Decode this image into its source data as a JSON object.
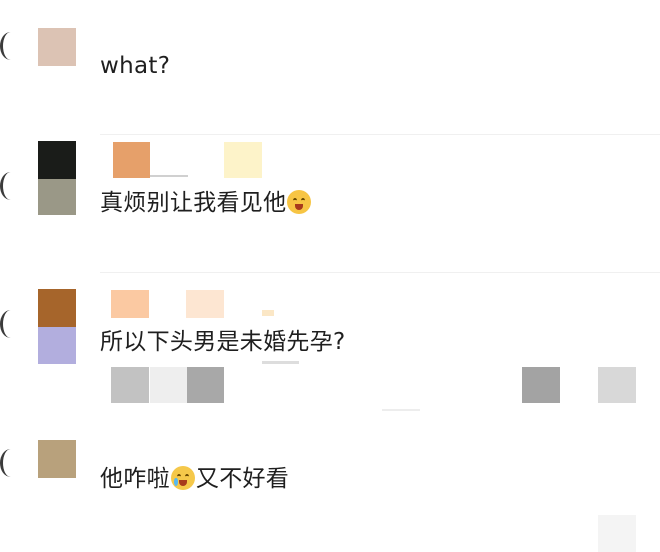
{
  "comments": [
    {
      "text": "what?"
    },
    {
      "text": "真烦别让我看见他",
      "emoji": "sweat-smile-emoji"
    },
    {
      "text": "所以下头男是未婚先孕?"
    },
    {
      "text_before": "他咋啦",
      "emoji": "crying-emoji",
      "text_after": "又不好看"
    }
  ],
  "colors": {
    "avatar1": "#dcc3b4",
    "avatar2_top": "#1a1c19",
    "avatar2_bottom": "#9a9887",
    "avatar3_top": "#a6652b",
    "avatar3_bottom": "#b2aede",
    "avatar4": "#b8a17c",
    "name2_a": "#e6a06a",
    "name2_b": "#fdf3c9",
    "name3_a": "#fbc9a2",
    "name3_b": "#fde6d2",
    "thumb_gray": "#b7b7b7"
  }
}
